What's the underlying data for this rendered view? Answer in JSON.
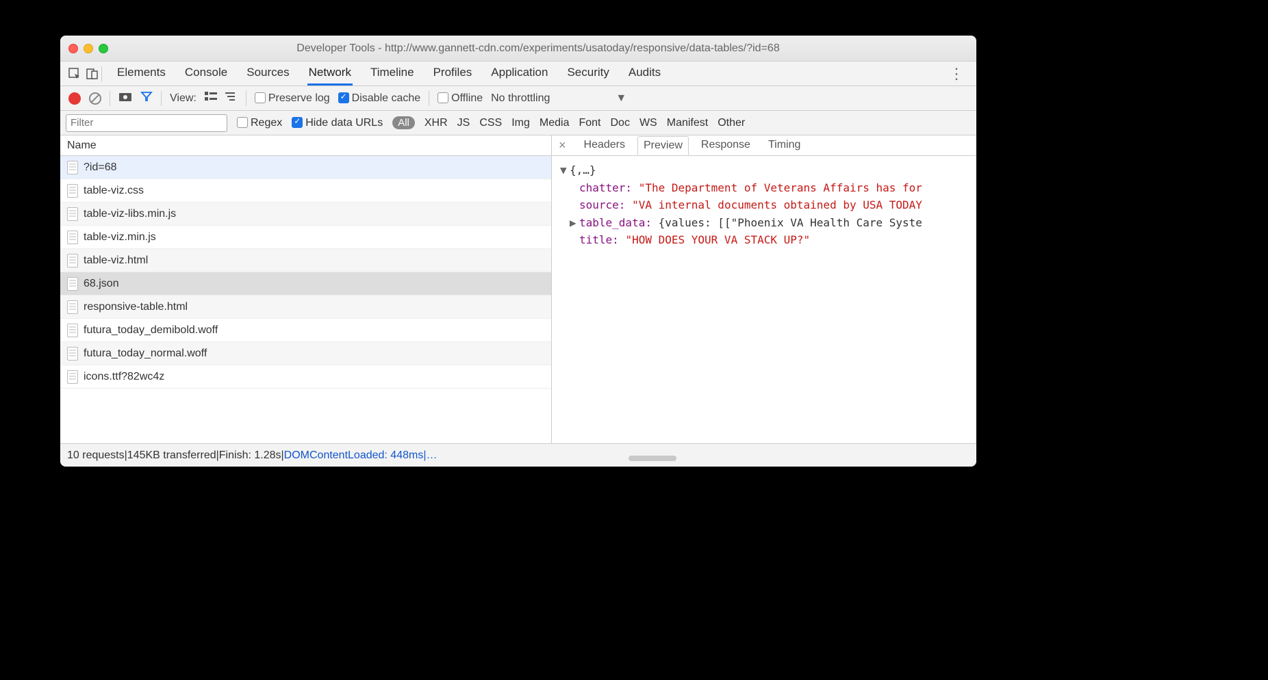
{
  "window": {
    "title": "Developer Tools - http://www.gannett-cdn.com/experiments/usatoday/responsive/data-tables/?id=68"
  },
  "tabs": {
    "items": [
      "Elements",
      "Console",
      "Sources",
      "Network",
      "Timeline",
      "Profiles",
      "Application",
      "Security",
      "Audits"
    ],
    "active_index": 3
  },
  "toolbar": {
    "view_label": "View:",
    "preserve_log": "Preserve log",
    "disable_cache": "Disable cache",
    "offline": "Offline",
    "throttling": "No throttling"
  },
  "filterbar": {
    "placeholder": "Filter",
    "regex_label": "Regex",
    "hide_data_urls_label": "Hide data URLs",
    "all_label": "All",
    "types": [
      "XHR",
      "JS",
      "CSS",
      "Img",
      "Media",
      "Font",
      "Doc",
      "WS",
      "Manifest",
      "Other"
    ]
  },
  "namecol_header": "Name",
  "requests": [
    {
      "name": "?id=68",
      "highlighted": true
    },
    {
      "name": "table-viz.css",
      "highlighted": false
    },
    {
      "name": "table-viz-libs.min.js",
      "highlighted": false
    },
    {
      "name": "table-viz.min.js",
      "highlighted": false
    },
    {
      "name": "table-viz.html",
      "highlighted": false
    },
    {
      "name": "68.json",
      "highlighted": false,
      "selected": true
    },
    {
      "name": "responsive-table.html",
      "highlighted": false
    },
    {
      "name": "futura_today_demibold.woff",
      "highlighted": false
    },
    {
      "name": "futura_today_normal.woff",
      "highlighted": false
    },
    {
      "name": "icons.ttf?82wc4z",
      "highlighted": false
    }
  ],
  "detail_tabs": {
    "items": [
      "Headers",
      "Preview",
      "Response",
      "Timing"
    ],
    "active_index": 1
  },
  "preview": {
    "root_display": "{,…}",
    "chatter_key": "chatter:",
    "chatter_value": "\"The Department of Veterans Affairs has for",
    "source_key": "source:",
    "source_value": "\"VA internal documents obtained by USA TODAY",
    "table_data_key": "table_data:",
    "table_data_value": "{values: [[\"Phoenix VA Health Care Syste",
    "title_key": "title:",
    "title_value": "\"HOW DOES YOUR VA STACK UP?\""
  },
  "status": {
    "requests": "10 requests",
    "transferred": "145KB transferred",
    "finish": "Finish: 1.28s",
    "dcl": "DOMContentLoaded: 448ms",
    "sep": " | ",
    "tail": " |…"
  }
}
